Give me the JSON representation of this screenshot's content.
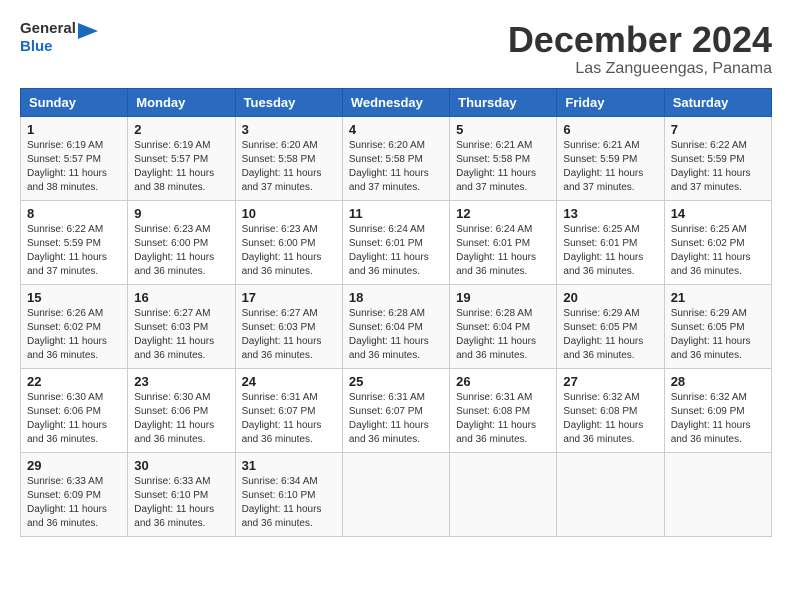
{
  "header": {
    "logo_line1": "General",
    "logo_line2": "Blue",
    "month_title": "December 2024",
    "subtitle": "Las Zangueengas, Panama"
  },
  "days_of_week": [
    "Sunday",
    "Monday",
    "Tuesday",
    "Wednesday",
    "Thursday",
    "Friday",
    "Saturday"
  ],
  "weeks": [
    [
      {
        "day": "1",
        "sunrise": "6:19 AM",
        "sunset": "5:57 PM",
        "daylight": "11 hours and 38 minutes."
      },
      {
        "day": "2",
        "sunrise": "6:19 AM",
        "sunset": "5:57 PM",
        "daylight": "11 hours and 38 minutes."
      },
      {
        "day": "3",
        "sunrise": "6:20 AM",
        "sunset": "5:58 PM",
        "daylight": "11 hours and 37 minutes."
      },
      {
        "day": "4",
        "sunrise": "6:20 AM",
        "sunset": "5:58 PM",
        "daylight": "11 hours and 37 minutes."
      },
      {
        "day": "5",
        "sunrise": "6:21 AM",
        "sunset": "5:58 PM",
        "daylight": "11 hours and 37 minutes."
      },
      {
        "day": "6",
        "sunrise": "6:21 AM",
        "sunset": "5:59 PM",
        "daylight": "11 hours and 37 minutes."
      },
      {
        "day": "7",
        "sunrise": "6:22 AM",
        "sunset": "5:59 PM",
        "daylight": "11 hours and 37 minutes."
      }
    ],
    [
      {
        "day": "8",
        "sunrise": "6:22 AM",
        "sunset": "5:59 PM",
        "daylight": "11 hours and 37 minutes."
      },
      {
        "day": "9",
        "sunrise": "6:23 AM",
        "sunset": "6:00 PM",
        "daylight": "11 hours and 36 minutes."
      },
      {
        "day": "10",
        "sunrise": "6:23 AM",
        "sunset": "6:00 PM",
        "daylight": "11 hours and 36 minutes."
      },
      {
        "day": "11",
        "sunrise": "6:24 AM",
        "sunset": "6:01 PM",
        "daylight": "11 hours and 36 minutes."
      },
      {
        "day": "12",
        "sunrise": "6:24 AM",
        "sunset": "6:01 PM",
        "daylight": "11 hours and 36 minutes."
      },
      {
        "day": "13",
        "sunrise": "6:25 AM",
        "sunset": "6:01 PM",
        "daylight": "11 hours and 36 minutes."
      },
      {
        "day": "14",
        "sunrise": "6:25 AM",
        "sunset": "6:02 PM",
        "daylight": "11 hours and 36 minutes."
      }
    ],
    [
      {
        "day": "15",
        "sunrise": "6:26 AM",
        "sunset": "6:02 PM",
        "daylight": "11 hours and 36 minutes."
      },
      {
        "day": "16",
        "sunrise": "6:27 AM",
        "sunset": "6:03 PM",
        "daylight": "11 hours and 36 minutes."
      },
      {
        "day": "17",
        "sunrise": "6:27 AM",
        "sunset": "6:03 PM",
        "daylight": "11 hours and 36 minutes."
      },
      {
        "day": "18",
        "sunrise": "6:28 AM",
        "sunset": "6:04 PM",
        "daylight": "11 hours and 36 minutes."
      },
      {
        "day": "19",
        "sunrise": "6:28 AM",
        "sunset": "6:04 PM",
        "daylight": "11 hours and 36 minutes."
      },
      {
        "day": "20",
        "sunrise": "6:29 AM",
        "sunset": "6:05 PM",
        "daylight": "11 hours and 36 minutes."
      },
      {
        "day": "21",
        "sunrise": "6:29 AM",
        "sunset": "6:05 PM",
        "daylight": "11 hours and 36 minutes."
      }
    ],
    [
      {
        "day": "22",
        "sunrise": "6:30 AM",
        "sunset": "6:06 PM",
        "daylight": "11 hours and 36 minutes."
      },
      {
        "day": "23",
        "sunrise": "6:30 AM",
        "sunset": "6:06 PM",
        "daylight": "11 hours and 36 minutes."
      },
      {
        "day": "24",
        "sunrise": "6:31 AM",
        "sunset": "6:07 PM",
        "daylight": "11 hours and 36 minutes."
      },
      {
        "day": "25",
        "sunrise": "6:31 AM",
        "sunset": "6:07 PM",
        "daylight": "11 hours and 36 minutes."
      },
      {
        "day": "26",
        "sunrise": "6:31 AM",
        "sunset": "6:08 PM",
        "daylight": "11 hours and 36 minutes."
      },
      {
        "day": "27",
        "sunrise": "6:32 AM",
        "sunset": "6:08 PM",
        "daylight": "11 hours and 36 minutes."
      },
      {
        "day": "28",
        "sunrise": "6:32 AM",
        "sunset": "6:09 PM",
        "daylight": "11 hours and 36 minutes."
      }
    ],
    [
      {
        "day": "29",
        "sunrise": "6:33 AM",
        "sunset": "6:09 PM",
        "daylight": "11 hours and 36 minutes."
      },
      {
        "day": "30",
        "sunrise": "6:33 AM",
        "sunset": "6:10 PM",
        "daylight": "11 hours and 36 minutes."
      },
      {
        "day": "31",
        "sunrise": "6:34 AM",
        "sunset": "6:10 PM",
        "daylight": "11 hours and 36 minutes."
      },
      null,
      null,
      null,
      null
    ]
  ]
}
